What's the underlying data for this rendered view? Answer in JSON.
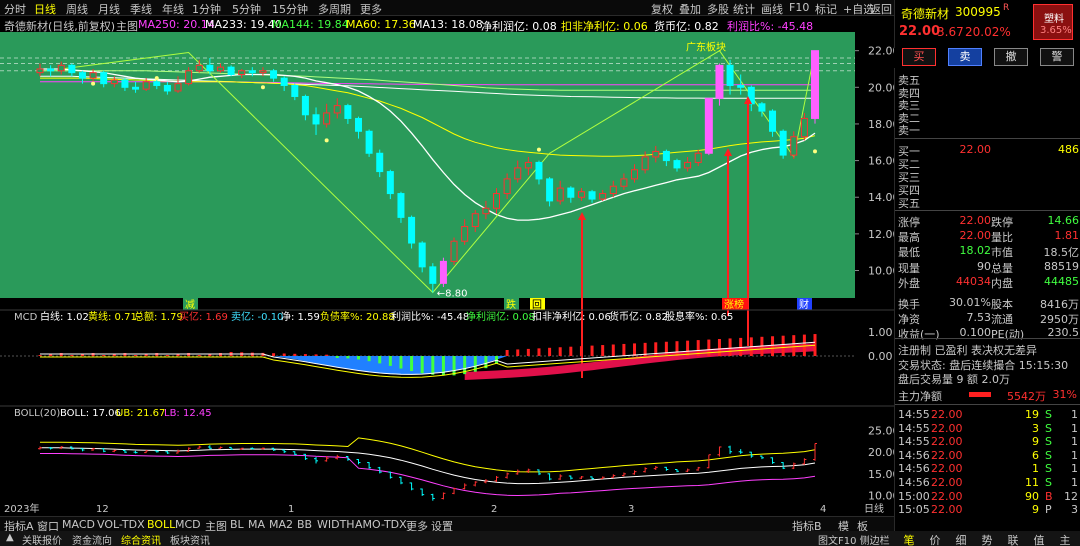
{
  "periods": [
    "分时",
    "日线",
    "周线",
    "月线",
    "季线",
    "年线",
    "1分钟",
    "5分钟",
    "15分钟",
    "多周期",
    "更多"
  ],
  "active_period": "日线",
  "tools": [
    "复权",
    "叠加",
    "多股",
    "统计",
    "画线",
    "F10",
    "标记",
    "+自选",
    "返回"
  ],
  "legend": {
    "title": "奇德新材(日线,前复权)",
    "main": "主图",
    "items": [
      {
        "text": "MA250: 20.14",
        "color": "#ff40ff"
      },
      {
        "text": "MA233: 19.40",
        "color": "#ffffff"
      },
      {
        "text": "MA144: 19.84",
        "color": "#40ff40"
      },
      {
        "text": "MA60: 17.36",
        "color": "#ffff00"
      },
      {
        "text": "MA13: 18.08",
        "color": "#ffffff"
      },
      {
        "text": "净利润亿: 0.08",
        "color": "#ffffff"
      },
      {
        "text": "扣非净利亿: 0.06",
        "color": "#ffff00"
      },
      {
        "text": "货币亿: 0.82",
        "color": "#ffffff"
      },
      {
        "text": "利润比%: -45.48",
        "color": "#ff40ff"
      }
    ]
  },
  "quote": {
    "name": "奇德新材",
    "code": "300995",
    "flag": "R",
    "price": "22.00",
    "change": "3.67",
    "pct": "20.02%",
    "badge_top": "塑料",
    "badge_pct": "3.65%"
  },
  "trade_buttons": [
    "买",
    "卖",
    "撤",
    "警"
  ],
  "orderbook": {
    "asks": [
      "卖五",
      "卖四",
      "卖三",
      "卖二",
      "卖一"
    ],
    "bids": [
      {
        "label": "买一",
        "price": "22.00",
        "vol": "486"
      },
      {
        "label": "买二",
        "price": "",
        "vol": ""
      },
      {
        "label": "买三",
        "price": "",
        "vol": ""
      },
      {
        "label": "买四",
        "price": "",
        "vol": ""
      },
      {
        "label": "买五",
        "price": "",
        "vol": ""
      }
    ]
  },
  "stats": [
    {
      "l1": "涨停",
      "v1": "22.00",
      "l2": "跌停",
      "v2": "14.66",
      "c1": "#ff3030",
      "c2": "#40ff40"
    },
    {
      "l1": "最高",
      "v1": "22.00",
      "l2": "量比",
      "v2": "1.81",
      "c1": "#ff3030",
      "c2": "#ff3030"
    },
    {
      "l1": "最低",
      "v1": "18.02",
      "l2": "市值",
      "v2": "18.5亿",
      "c1": "#40ff40",
      "c2": "#c8c8c8"
    },
    {
      "l1": "现量",
      "v1": "90",
      "l2": "总量",
      "v2": "88519",
      "c1": "#c8c8c8",
      "c2": "#c8c8c8"
    },
    {
      "l1": "外盘",
      "v1": "44034",
      "l2": "内盘",
      "v2": "44485",
      "c1": "#ff3030",
      "c2": "#40ff40"
    },
    {
      "l1": "换手",
      "v1": "30.01%",
      "l2": "股本",
      "v2": "8416万",
      "c1": "#c8c8c8",
      "c2": "#c8c8c8"
    },
    {
      "l1": "净资",
      "v1": "7.53",
      "l2": "流通",
      "v2": "2950万",
      "c1": "#c8c8c8",
      "c2": "#c8c8c8"
    },
    {
      "l1": "收益(一)",
      "v1": "0.100",
      "l2": "PE(动)",
      "v2": "230.5",
      "c1": "#c8c8c8",
      "c2": "#c8c8c8"
    }
  ],
  "info_lines": [
    "注册制 已盈利 表决权无差异",
    "交易状态: 盘后连续撮合 15:15:30",
    "盘后交易量 9 额 2.0万"
  ],
  "main_net": {
    "label": "主力净额",
    "value": "5542万",
    "pct": "31%"
  },
  "ticks": [
    {
      "t": "14:55",
      "p": "22.00",
      "v": "19",
      "s": "S",
      "n": "1"
    },
    {
      "t": "14:55",
      "p": "22.00",
      "v": "3",
      "s": "S",
      "n": "1"
    },
    {
      "t": "14:55",
      "p": "22.00",
      "v": "9",
      "s": "S",
      "n": "1"
    },
    {
      "t": "14:56",
      "p": "22.00",
      "v": "6",
      "s": "S",
      "n": "1"
    },
    {
      "t": "14:56",
      "p": "22.00",
      "v": "1",
      "s": "S",
      "n": "1"
    },
    {
      "t": "14:56",
      "p": "22.00",
      "v": "11",
      "s": "S",
      "n": "1"
    },
    {
      "t": "15:00",
      "p": "22.00",
      "v": "90",
      "s": "B",
      "n": "12"
    },
    {
      "t": "15:05",
      "p": "22.00",
      "v": "9",
      "s": "P",
      "n": "3"
    }
  ],
  "macd_legend": [
    {
      "text": "MCD",
      "color": "#c8c8c8"
    },
    {
      "text": "白线: 1.02",
      "color": "#ffffff"
    },
    {
      "text": "黄线: 0.71",
      "color": "#ffff00"
    },
    {
      "text": "总额: 1.79",
      "color": "#ffff00"
    },
    {
      "text": "买亿: 1.69",
      "color": "#ff3030"
    },
    {
      "text": "卖亿: -0.10",
      "color": "#40e0ff"
    },
    {
      "text": "净: 1.59",
      "color": "#ffffff"
    },
    {
      "text": "负债率%: 20.88",
      "color": "#ffff00"
    },
    {
      "text": "利润比%: -45.48",
      "color": "#ffffff"
    },
    {
      "text": "净利润亿: 0.08",
      "color": "#40ff40"
    },
    {
      "text": "扣非净利亿: 0.06",
      "color": "#ffffff"
    },
    {
      "text": "货币亿: 0.82",
      "color": "#ffffff"
    },
    {
      "text": "股息率%: 0.65",
      "color": "#ffffff"
    }
  ],
  "boll_legend": [
    {
      "text": "BOLL(20)",
      "color": "#c8c8c8"
    },
    {
      "text": "BOLL: 17.06",
      "color": "#ffffff"
    },
    {
      "text": "UB: 21.67",
      "color": "#ffff00"
    },
    {
      "text": "LB: 12.45",
      "color": "#ff40ff"
    }
  ],
  "axis": {
    "main_ticks": [
      "22.00",
      "20.00",
      "18.00",
      "16.00",
      "14.00",
      "12.00",
      "10.00"
    ],
    "macd_ticks": [
      "1.00",
      "0.00"
    ],
    "boll_ticks": [
      "25.00",
      "20.00",
      "15.00",
      "10.00"
    ],
    "x_labels": [
      "2023年",
      "12",
      "1",
      "2",
      "3",
      "4"
    ],
    "low_label": "8.80",
    "sector_label": "广东板块",
    "period_label": "日线"
  },
  "markers": [
    "减",
    "跌",
    "回",
    "涨榜",
    "财"
  ],
  "bottom_tabs": [
    "指标A",
    "窗口",
    "MACD",
    "VOL-TDX",
    "BOLL",
    "MCD",
    "主图",
    "BL",
    "MA",
    "MA2",
    "BB",
    "WIDTH",
    "AMO-TDX",
    "更多",
    "设置"
  ],
  "bottom_active": "BOLL",
  "bottom_right": [
    "指标B",
    "模",
    "板"
  ],
  "status": [
    {
      "text": "关联报价",
      "color": "#c8c8c8"
    },
    {
      "text": "资金流向",
      "color": "#c8c8c8"
    },
    {
      "text": "综合资讯",
      "color": "#ffff00"
    },
    {
      "text": "板块资讯",
      "color": "#c8c8c8"
    }
  ],
  "status_right": "图文F10 侧边栏",
  "side_tabs": [
    "笔",
    "价",
    "细",
    "势",
    "联",
    "值",
    "主"
  ],
  "chart_data": {
    "type": "candlestick",
    "ylim": [
      8.5,
      22.8
    ],
    "candles": [
      [
        20.8,
        21.0,
        21.3,
        20.6
      ],
      [
        21.0,
        20.9,
        21.2,
        20.6
      ],
      [
        20.9,
        21.2,
        21.4,
        20.7
      ],
      [
        21.2,
        20.8,
        21.3,
        20.6
      ],
      [
        20.8,
        20.5,
        20.9,
        20.2
      ],
      [
        20.5,
        20.8,
        21.0,
        20.3
      ],
      [
        20.8,
        20.2,
        20.9,
        20.0
      ],
      [
        20.2,
        20.4,
        20.6,
        20.0
      ],
      [
        20.4,
        20.0,
        20.5,
        19.8
      ],
      [
        20.0,
        19.9,
        20.3,
        19.7
      ],
      [
        19.9,
        20.3,
        20.5,
        19.8
      ],
      [
        20.3,
        20.1,
        20.4,
        19.9
      ],
      [
        20.1,
        19.8,
        20.3,
        19.6
      ],
      [
        19.8,
        20.2,
        20.6,
        19.7
      ],
      [
        20.2,
        20.9,
        21.1,
        20.1
      ],
      [
        20.9,
        21.2,
        21.5,
        20.8
      ],
      [
        21.2,
        20.9,
        21.6,
        20.7
      ],
      [
        20.9,
        21.1,
        21.3,
        20.8
      ],
      [
        21.1,
        20.7,
        21.2,
        20.6
      ],
      [
        20.7,
        20.9,
        21.0,
        20.5
      ],
      [
        20.9,
        20.8,
        21.1,
        20.6
      ],
      [
        20.8,
        20.9,
        21.1,
        20.6
      ],
      [
        20.9,
        20.5,
        21.0,
        20.3
      ],
      [
        20.5,
        20.1,
        20.6,
        19.8
      ],
      [
        20.1,
        19.5,
        20.2,
        19.3
      ],
      [
        19.5,
        18.5,
        19.6,
        18.2
      ],
      [
        18.5,
        18.0,
        18.9,
        17.4
      ],
      [
        18.0,
        18.6,
        19.1,
        17.8
      ],
      [
        18.6,
        19.0,
        19.4,
        18.3
      ],
      [
        19.0,
        18.3,
        19.1,
        18.0
      ],
      [
        18.3,
        17.6,
        18.4,
        17.2
      ],
      [
        17.6,
        16.4,
        17.7,
        16.2
      ],
      [
        16.4,
        15.4,
        16.6,
        15.1
      ],
      [
        15.4,
        14.2,
        15.5,
        13.9
      ],
      [
        14.2,
        12.9,
        14.3,
        12.6
      ],
      [
        12.9,
        11.5,
        13.0,
        11.2
      ],
      [
        11.5,
        10.2,
        11.6,
        9.9
      ],
      [
        10.2,
        9.3,
        10.4,
        8.8
      ],
      [
        9.3,
        10.5,
        10.7,
        9.1
      ],
      [
        10.5,
        11.6,
        11.8,
        10.3
      ],
      [
        11.6,
        12.4,
        12.8,
        11.4
      ],
      [
        12.4,
        13.1,
        13.3,
        12.1
      ],
      [
        13.1,
        13.4,
        13.8,
        12.8
      ],
      [
        13.4,
        14.2,
        14.5,
        13.1
      ],
      [
        14.2,
        15.0,
        15.3,
        13.9
      ],
      [
        15.0,
        15.6,
        16.0,
        14.8
      ],
      [
        15.6,
        15.9,
        16.2,
        15.2
      ],
      [
        15.9,
        15.0,
        16.0,
        14.7
      ],
      [
        15.0,
        13.8,
        15.1,
        13.5
      ],
      [
        13.8,
        14.5,
        14.9,
        13.6
      ],
      [
        14.5,
        14.0,
        14.6,
        13.7
      ],
      [
        14.0,
        14.3,
        14.5,
        13.8
      ],
      [
        14.3,
        13.9,
        14.4,
        13.7
      ],
      [
        13.9,
        14.2,
        14.4,
        13.8
      ],
      [
        14.2,
        14.6,
        14.9,
        14.0
      ],
      [
        14.6,
        15.0,
        15.3,
        14.4
      ],
      [
        15.0,
        15.5,
        15.8,
        14.8
      ],
      [
        15.5,
        16.2,
        16.5,
        15.3
      ],
      [
        16.2,
        16.5,
        16.8,
        15.9
      ],
      [
        16.5,
        16.0,
        16.6,
        15.7
      ],
      [
        16.0,
        15.6,
        16.1,
        15.4
      ],
      [
        15.6,
        15.9,
        16.2,
        15.4
      ],
      [
        15.9,
        16.4,
        16.6,
        15.7
      ],
      [
        16.4,
        19.4,
        19.4,
        16.3
      ],
      [
        19.4,
        21.2,
        21.3,
        19.0
      ],
      [
        21.2,
        20.1,
        21.5,
        19.6
      ],
      [
        20.1,
        20.0,
        20.7,
        19.6
      ],
      [
        20.0,
        19.1,
        20.1,
        18.7
      ],
      [
        19.1,
        18.7,
        19.2,
        18.4
      ],
      [
        18.7,
        17.6,
        18.8,
        17.3
      ],
      [
        17.6,
        16.3,
        17.7,
        16.1
      ],
      [
        16.3,
        17.3,
        17.6,
        16.1
      ],
      [
        17.3,
        18.3,
        18.6,
        17.1
      ],
      [
        18.3,
        22.0,
        22.0,
        18.02
      ]
    ],
    "ma13": [
      21.0,
      21.0,
      21.0,
      20.95,
      20.9,
      20.85,
      20.8,
      20.7,
      20.6,
      20.5,
      20.45,
      20.4,
      20.35,
      20.3,
      20.35,
      20.45,
      20.55,
      20.6,
      20.65,
      20.7,
      20.7,
      20.7,
      20.7,
      20.65,
      20.6,
      20.5,
      20.35,
      20.25,
      20.15,
      20.0,
      19.8,
      19.5,
      19.15,
      18.7,
      18.15,
      17.5,
      16.8,
      16.05,
      15.35,
      14.7,
      14.15,
      13.7,
      13.35,
      13.05,
      12.85,
      12.75,
      12.75,
      12.8,
      12.9,
      13.05,
      13.2,
      13.4,
      13.6,
      13.8,
      14.0,
      14.2,
      14.35,
      14.5,
      14.65,
      14.8,
      14.95,
      15.05,
      15.15,
      15.35,
      15.65,
      15.95,
      16.25,
      16.45,
      16.6,
      16.7,
      16.75,
      16.9,
      17.1,
      17.5
    ],
    "ma60": [
      20.5,
      20.5,
      20.5,
      20.5,
      20.5,
      20.48,
      20.46,
      20.44,
      20.42,
      20.4,
      20.38,
      20.36,
      20.34,
      20.32,
      20.3,
      20.3,
      20.3,
      20.3,
      20.3,
      20.28,
      20.26,
      20.24,
      20.22,
      20.2,
      20.15,
      20.1,
      20.0,
      19.9,
      19.8,
      19.7,
      19.55,
      19.4,
      19.25,
      19.05,
      18.85,
      18.6,
      18.35,
      18.05,
      17.75,
      17.45,
      17.2,
      17.0,
      16.85,
      16.7,
      16.6,
      16.52,
      16.45,
      16.4,
      16.35,
      16.3,
      16.28,
      16.26,
      16.25,
      16.24,
      16.24,
      16.25,
      16.27,
      16.3,
      16.35,
      16.4,
      16.45,
      16.5,
      16.55,
      16.62,
      16.72,
      16.82,
      16.9,
      16.96,
      17.02,
      17.06,
      17.1,
      17.15,
      17.22,
      17.36
    ],
    "ma144": [
      20.9,
      20.9,
      20.9,
      20.9,
      20.9,
      20.9,
      20.9,
      20.9,
      20.9,
      20.9,
      20.9,
      20.88,
      20.86,
      20.84,
      20.82,
      20.8,
      20.78,
      20.76,
      20.74,
      20.72,
      20.7,
      20.68,
      20.66,
      20.64,
      20.62,
      20.6,
      20.57,
      20.54,
      20.51,
      20.48,
      20.45,
      20.42,
      20.38,
      20.34,
      20.3,
      20.26,
      20.22,
      20.18,
      20.14,
      20.1,
      20.06,
      20.02,
      19.98,
      19.95,
      19.92,
      19.9,
      19.88,
      19.86,
      19.85,
      19.84,
      19.84,
      19.84,
      19.84,
      19.84,
      19.84,
      19.84,
      19.84,
      19.84,
      19.84,
      19.84,
      19.84,
      19.84,
      19.84,
      19.84,
      19.84,
      19.84,
      19.84,
      19.84,
      19.84,
      19.84,
      19.84,
      19.84,
      19.84,
      19.84
    ],
    "ma233": [
      20.6,
      20.6,
      20.6,
      20.6,
      20.58,
      20.56,
      20.54,
      20.52,
      20.5,
      20.48,
      20.46,
      20.44,
      20.42,
      20.4,
      20.38,
      20.36,
      20.34,
      20.32,
      20.3,
      20.28,
      20.26,
      20.24,
      20.22,
      20.2,
      20.18,
      20.16,
      20.14,
      20.12,
      20.1,
      20.08,
      20.05,
      20.02,
      19.99,
      19.96,
      19.93,
      19.9,
      19.87,
      19.84,
      19.81,
      19.78,
      19.75,
      19.72,
      19.69,
      19.66,
      19.63,
      19.6,
      19.58,
      19.56,
      19.54,
      19.52,
      19.5,
      19.49,
      19.48,
      19.47,
      19.46,
      19.45,
      19.44,
      19.43,
      19.42,
      19.42,
      19.41,
      19.41,
      19.41,
      19.4,
      19.4,
      19.4,
      19.4,
      19.4,
      19.4,
      19.4,
      19.4,
      19.4,
      19.4,
      19.4
    ],
    "ma250": [
      20.3,
      20.3,
      20.3,
      20.3,
      20.3,
      20.3,
      20.3,
      20.3,
      20.3,
      20.3,
      20.3,
      20.3,
      20.3,
      20.3,
      20.3,
      20.3,
      20.3,
      20.3,
      20.3,
      20.29,
      20.28,
      20.27,
      20.26,
      20.25,
      20.24,
      20.23,
      20.22,
      20.21,
      20.2,
      20.2,
      20.19,
      20.19,
      20.18,
      20.18,
      20.17,
      20.17,
      20.16,
      20.16,
      20.16,
      20.15,
      20.15,
      20.15,
      20.15,
      20.14,
      20.14,
      20.14,
      20.14,
      20.14,
      20.14,
      20.14,
      20.14,
      20.14,
      20.14,
      20.14,
      20.14,
      20.14,
      20.14,
      20.14,
      20.14,
      20.14,
      20.14,
      20.14,
      20.14,
      20.14,
      20.14,
      20.14,
      20.14,
      20.14,
      20.14,
      20.14,
      20.14,
      20.14,
      20.14,
      20.14
    ]
  }
}
